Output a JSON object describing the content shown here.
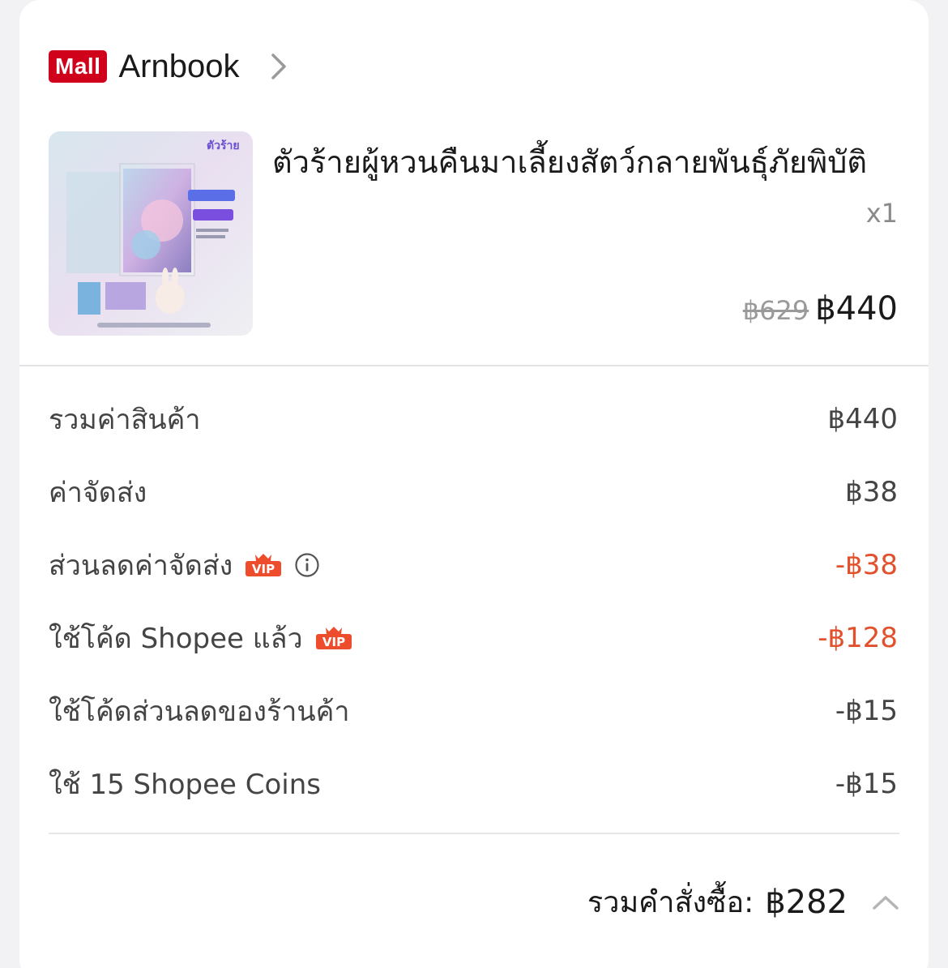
{
  "shop": {
    "badge": "Mall",
    "name": "Arnbook",
    "chevron_icon": "chevron-right-icon"
  },
  "product": {
    "title": "ตัวร้ายผู้หวนคืนมาเลี้ยงสัตว์กลายพันธุ์ภัยพิบัติ",
    "quantity": "x1",
    "original_price": "฿629",
    "price": "฿440",
    "thumbnail_icon": "book-cover-image"
  },
  "summary": {
    "rows": [
      {
        "label": "รวมค่าสินค้า",
        "value": "฿440",
        "color": "#444444"
      },
      {
        "label": "ค่าจัดส่ง",
        "value": "฿38",
        "color": "#444444"
      },
      {
        "label": "ส่วนลดค่าจัดส่ง",
        "value": "-฿38",
        "color": "#e2502c",
        "badge": "VIP",
        "info_icon": "info-icon"
      },
      {
        "label": "ใช้โค้ด Shopee แล้ว",
        "value": "-฿128",
        "color": "#e2502c",
        "badge": "VIP"
      },
      {
        "label": "ใช้โค้ดส่วนลดของร้านค้า",
        "value": "-฿15",
        "color": "#444444"
      },
      {
        "label": "ใช้ 15 Shopee Coins",
        "value": "-฿15",
        "color": "#444444"
      }
    ]
  },
  "total": {
    "label": "รวมคำสั่งซื้อ:",
    "value": "฿282",
    "chevron_icon": "chevron-up-icon"
  },
  "colors": {
    "mall_red": "#d0011b",
    "discount_red": "#e2502c",
    "vip_orange": "#ee4d2d"
  }
}
